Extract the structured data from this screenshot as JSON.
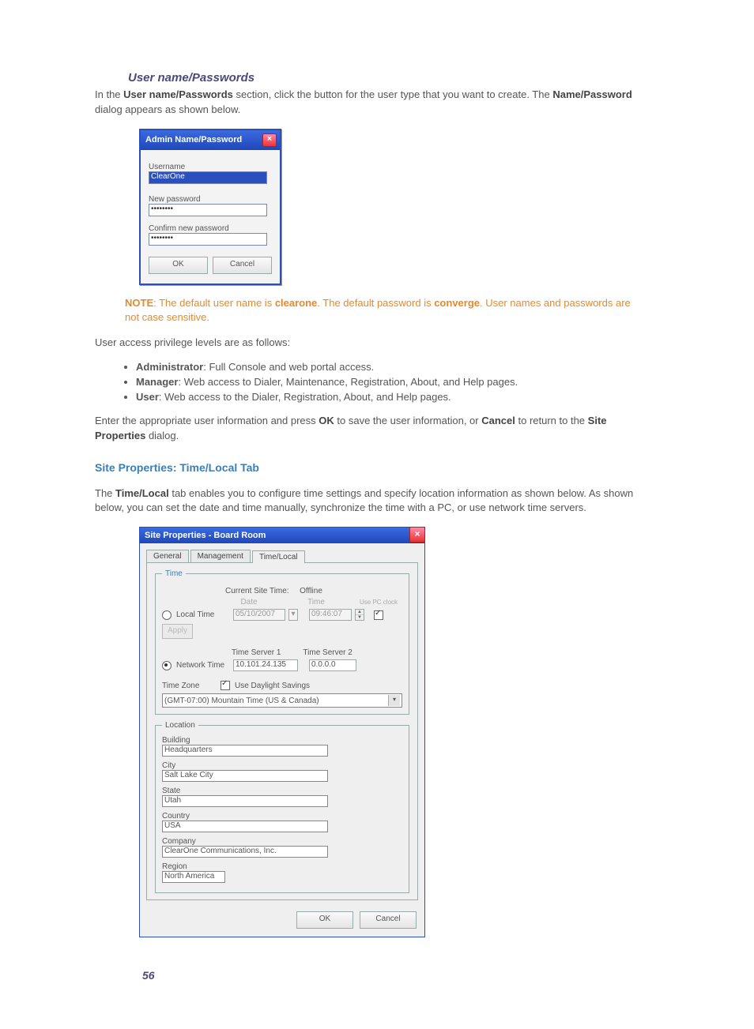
{
  "heading1": "User name/Passwords",
  "intro": {
    "p1a": "In the ",
    "p1b": "User name/Passwords",
    "p1c": " section, click the button for the user type that you want to create. The ",
    "p1d": "Name/Password",
    "p1e": " dialog appears as shown below."
  },
  "dlg1": {
    "title": "Admin Name/Password",
    "close": "×",
    "username_label": "Username",
    "username_value": "ClearOne",
    "newpwd_label": "New password",
    "newpwd_value": "••••••••",
    "confirm_label": "Confirm new password",
    "confirm_value": "••••••••",
    "ok": "OK",
    "cancel": "Cancel"
  },
  "note": {
    "lead": "NOTE",
    "t1": ": The default user name is ",
    "w1": "clearone",
    "t2": ". The default password is ",
    "w2": "converge",
    "t3": ". User names and passwords are not case sensitive."
  },
  "privline": "User access privilege levels are as follows:",
  "bullets": {
    "b1a": "Administrator",
    "b1b": ": Full Console and web portal access.",
    "b2a": "Manager",
    "b2b": ":  Web access to Dialer, Maintenance, Registration, About, and Help pages.",
    "b3a": "User",
    "b3b": ": Web access to the Dialer, Registration, About, and Help pages."
  },
  "enter": {
    "a": "Enter the appropriate user information and press ",
    "ok": "OK",
    "b": " to save the user information, or ",
    "cancel": "Cancel",
    "c": " to return to the ",
    "sp": "Site Properties",
    "d": " dialog."
  },
  "blue_heading": "Site Properties: Time/Local Tab",
  "tl_para": {
    "a": "The ",
    "b": "Time/Local",
    "c": " tab enables you to configure time settings and specify location information as shown below. As shown below, you can set the date and time manually, synchronize the time with a PC, or use network time servers."
  },
  "dlg2": {
    "title": "Site Properties - Board Room",
    "close": "×",
    "tabs": {
      "general": "General",
      "management": "Management",
      "timelocal": "Time/Local"
    },
    "time": {
      "legend": "Time",
      "cst_label": "Current Site Time:",
      "cst_value": "Offline",
      "date_hdr": "Date",
      "time_hdr": "Time",
      "usepc": "Use PC clock",
      "local_radio": "Local Time",
      "date_value": "05/10/2007",
      "time_value": "09:46:07",
      "apply": "Apply",
      "net_radio": "Network Time",
      "ts1_hdr": "Time Server 1",
      "ts2_hdr": "Time Server 2",
      "ts1_value": "10.101.24.135",
      "ts2_value": "0.0.0.0",
      "dst": "Use Daylight Savings",
      "tz_label": "Time Zone",
      "tz_value": "(GMT-07:00) Mountain Time (US & Canada)"
    },
    "loc": {
      "legend": "Location",
      "building_l": "Building",
      "building_v": "Headquarters",
      "city_l": "City",
      "city_v": "Salt Lake City",
      "state_l": "State",
      "state_v": "Utah",
      "country_l": "Country",
      "country_v": "USA",
      "company_l": "Company",
      "company_v": "ClearOne Communications, Inc.",
      "region_l": "Region",
      "region_v": "North America"
    },
    "ok": "OK",
    "cancel": "Cancel"
  },
  "pagenum": "56"
}
